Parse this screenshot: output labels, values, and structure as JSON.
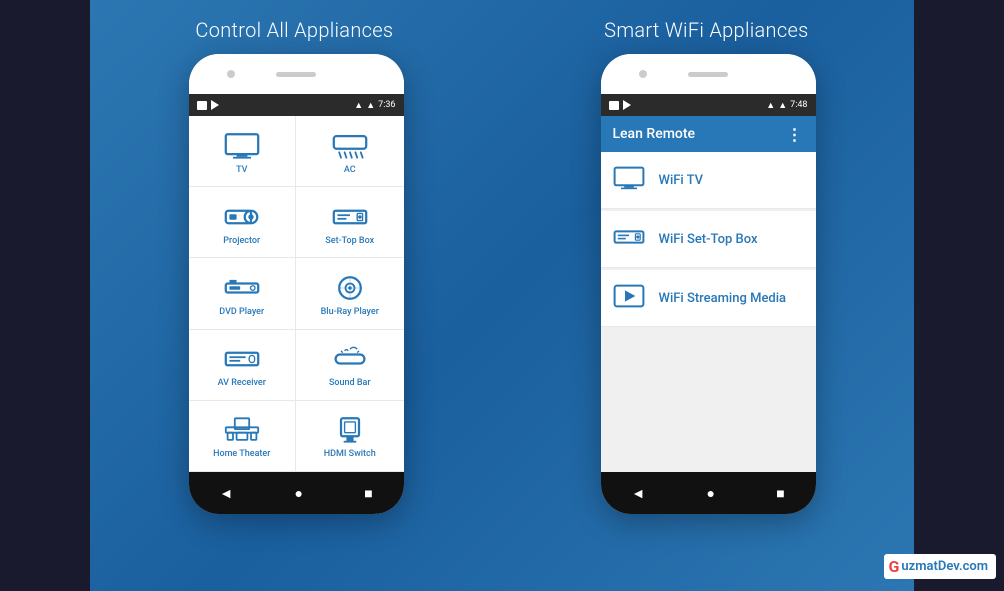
{
  "left_section": {
    "title": "Control All Appliances",
    "status_time": "7:36",
    "grid_items": [
      {
        "label": "TV",
        "icon": "tv"
      },
      {
        "label": "AC",
        "icon": "ac"
      },
      {
        "label": "Projector",
        "icon": "projector"
      },
      {
        "label": "Set-Top Box",
        "icon": "settopbox"
      },
      {
        "label": "DVD Player",
        "icon": "dvd"
      },
      {
        "label": "Blu-Ray Player",
        "icon": "bluray"
      },
      {
        "label": "AV Receiver",
        "icon": "avreceiver"
      },
      {
        "label": "Sound Bar",
        "icon": "soundbar"
      },
      {
        "label": "Home Theater",
        "icon": "hometheater"
      },
      {
        "label": "HDMI Switch",
        "icon": "hdmi"
      }
    ],
    "nav": [
      "◄",
      "●",
      "■"
    ]
  },
  "right_section": {
    "title": "Smart WiFi Appliances",
    "status_time": "7:48",
    "app_title": "Lean Remote",
    "list_items": [
      {
        "label": "WiFi TV",
        "icon": "tv"
      },
      {
        "label": "WiFi Set-Top Box",
        "icon": "settopbox"
      },
      {
        "label": "WiFi Streaming Media",
        "icon": "streaming"
      }
    ],
    "nav": [
      "◄",
      "●",
      "■"
    ]
  },
  "watermark": {
    "logo": "G",
    "text_plain": "uzmat",
    "text_colored": "Dev",
    "domain": ".com"
  }
}
